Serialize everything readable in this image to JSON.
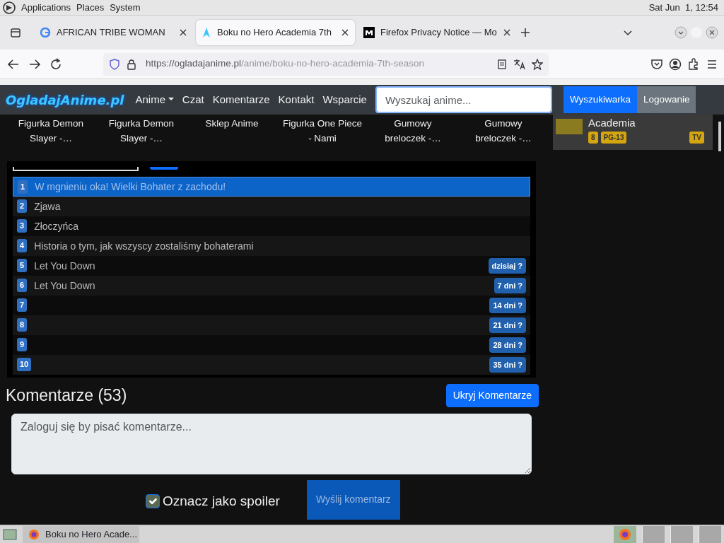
{
  "top_panel": {
    "menus": [
      "Applications",
      "Places",
      "System"
    ],
    "clock": "Sat Jun  1, 12:54"
  },
  "browser": {
    "tabs": [
      {
        "title": "AFRICAN TRIBE WOMAN",
        "selected": false,
        "kind": "google"
      },
      {
        "title": "Boku no Hero Academia 7th",
        "selected": true,
        "kind": "site"
      },
      {
        "title": "Firefox Privacy Notice — Mo",
        "selected": false,
        "kind": "m"
      }
    ],
    "url_host": "https://ogladajanime.pl",
    "url_path": "/anime/boku-no-hero-academia-7th-season"
  },
  "site_nav": {
    "brand": "OgladajAnime.pl",
    "links": [
      {
        "label": "Anime",
        "dropdown": true
      },
      {
        "label": "Czat",
        "dropdown": false
      },
      {
        "label": "Komentarze",
        "dropdown": false
      },
      {
        "label": "Kontakt",
        "dropdown": false
      },
      {
        "label": "Wsparcie",
        "dropdown": false
      }
    ],
    "search": {
      "placeholder": "Wyszukaj anime..."
    },
    "search_button": "Wyszukiwarka",
    "login_button": "Logowanie"
  },
  "products": [
    "Figurka Demon Slayer -…",
    "Figurka Demon Slayer -…",
    "Sklep Anime",
    "Figurka One Piece - Nami",
    "Gumowy breloczek -…",
    "Gumowy breloczek -…"
  ],
  "sidebar_card": {
    "title": "Academia",
    "badges": [
      "8",
      "PG-13"
    ],
    "type": "TV"
  },
  "episodes": [
    {
      "number": "1",
      "title": "W mgnieniu oka! Wielki Bohater z zachodu!",
      "selected": true
    },
    {
      "number": "2",
      "title": "Zjawa",
      "selected": false
    },
    {
      "number": "3",
      "title": "Złoczyńca",
      "selected": false
    },
    {
      "number": "4",
      "title": "Historia o tym, jak wszyscy zostaliśmy bohaterami",
      "selected": false
    },
    {
      "number": "5",
      "title": "Let You Down",
      "selected": false,
      "badge": "dzisiaj ?"
    },
    {
      "number": "6",
      "title": "Let You Down",
      "selected": false,
      "badge": "7 dni ?"
    },
    {
      "number": "7",
      "selected": false,
      "badge": "14 dni ?"
    },
    {
      "number": "8",
      "selected": false,
      "badge": "21 dni ?"
    },
    {
      "number": "9",
      "selected": false,
      "badge": "28 dni ?"
    },
    {
      "number": "10",
      "selected": false,
      "badge": "35 dni ?"
    }
  ],
  "comments": {
    "heading": "Komentarze (53)",
    "hide_button": "Ukryj Komentarze",
    "placeholder": "Zaloguj się by pisać komentarze...",
    "spoiler": {
      "label": "Oznacz jako spoiler",
      "checked": true
    },
    "submit": "Wyślij komentarz"
  },
  "taskbar": {
    "window": "Boku no Hero Acade..."
  }
}
